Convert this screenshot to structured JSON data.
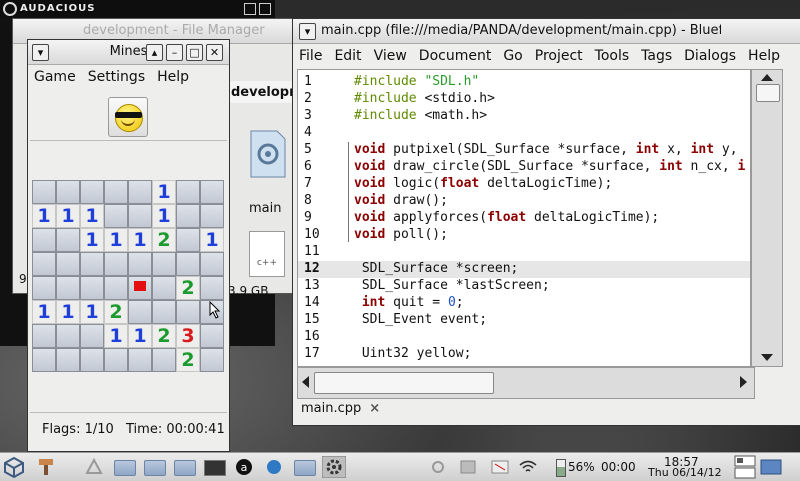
{
  "audacious": {
    "title": "AUDACIOUS"
  },
  "file_manager": {
    "title": "development - File Manager",
    "location": "developm",
    "file_label": "main",
    "doc_icon_text": "c++",
    "free_space": "3.9 GB",
    "left_digit": "9"
  },
  "mines": {
    "title": "Mines",
    "menu": [
      "Game",
      "Settings",
      "Help"
    ],
    "grid": [
      [
        "",
        "",
        "",
        "",
        "",
        "1",
        "",
        ""
      ],
      [
        "1",
        "1",
        "1",
        "",
        "",
        "1",
        "",
        ""
      ],
      [
        "",
        "",
        "1",
        "1",
        "1",
        "2",
        "",
        "1"
      ],
      [
        "",
        "",
        "",
        "",
        "",
        "",
        "",
        ""
      ],
      [
        "",
        "",
        "",
        "",
        "F",
        "",
        "2",
        ""
      ],
      [
        "1",
        "1",
        "1",
        "2",
        "",
        "",
        "",
        ""
      ],
      [
        "",
        "",
        "",
        "1",
        "1",
        "2",
        "3",
        ""
      ],
      [
        "",
        "",
        "",
        "",
        "",
        "",
        "2",
        ""
      ]
    ],
    "open": [
      [
        0,
        0,
        0,
        0,
        0,
        1,
        0,
        0
      ],
      [
        1,
        1,
        1,
        0,
        0,
        1,
        0,
        0
      ],
      [
        0,
        0,
        1,
        1,
        1,
        1,
        0,
        1
      ],
      [
        0,
        0,
        0,
        0,
        0,
        0,
        0,
        0
      ],
      [
        0,
        0,
        0,
        0,
        0,
        0,
        1,
        0
      ],
      [
        1,
        1,
        1,
        1,
        0,
        0,
        0,
        0
      ],
      [
        0,
        0,
        0,
        1,
        1,
        1,
        1,
        0
      ],
      [
        0,
        0,
        0,
        0,
        0,
        0,
        1,
        0
      ]
    ],
    "flags": "Flags: 1/10",
    "time": "Time: 00:00:41"
  },
  "bluefish": {
    "title": "main.cpp (file:///media/PANDA/development/main.cpp) - Bluef",
    "menu": [
      "File",
      "Edit",
      "View",
      "Document",
      "Go",
      "Project",
      "Tools",
      "Tags",
      "Dialogs",
      "Help"
    ],
    "current_line": 12,
    "lines": [
      {
        "n": "1",
        "html": "<span class='pp'>#include </span><span class='str'>\"SDL.h\"</span>"
      },
      {
        "n": "2",
        "html": "<span class='pp'>#include </span>&lt;stdio.h&gt;"
      },
      {
        "n": "3",
        "html": "<span class='pp'>#include </span>&lt;math.h&gt;"
      },
      {
        "n": "4",
        "html": ""
      },
      {
        "n": "5",
        "html": "<span class='kw'>void</span> putpixel(SDL_Surface *surface, <span class='kw'>int</span> x, <span class='kw'>int</span> y,"
      },
      {
        "n": "6",
        "html": "<span class='kw'>void</span> draw_circle(SDL_Surface *surface, <span class='kw'>int</span> n_cx, <span class='kw'>i</span>"
      },
      {
        "n": "7",
        "html": "<span class='kw'>void</span> logic(<span class='kw'>float</span> deltaLogicTime);"
      },
      {
        "n": "8",
        "html": "<span class='kw'>void</span> draw();"
      },
      {
        "n": "9",
        "html": "<span class='kw'>void</span> applyforces(<span class='kw'>float</span> deltaLogicTime);"
      },
      {
        "n": "10",
        "html": "<span class='kw'>void</span> poll();"
      },
      {
        "n": "11",
        "html": ""
      },
      {
        "n": "12",
        "html": " SDL_Surface *screen;"
      },
      {
        "n": "13",
        "html": " SDL_Surface *lastScreen;"
      },
      {
        "n": "14",
        "html": " <span class='kw'>int</span> quit = <span class='num'>0</span>;"
      },
      {
        "n": "15",
        "html": " SDL_Event event;"
      },
      {
        "n": "16",
        "html": ""
      },
      {
        "n": "17",
        "html": " Uint32 yellow;"
      }
    ],
    "tab_label": "main.cpp",
    "tab_close": "×"
  },
  "taskbar": {
    "battery": "56%",
    "battery_time": "00:00",
    "clock_time": "18:57",
    "clock_date": "Thu 06/14/12"
  }
}
